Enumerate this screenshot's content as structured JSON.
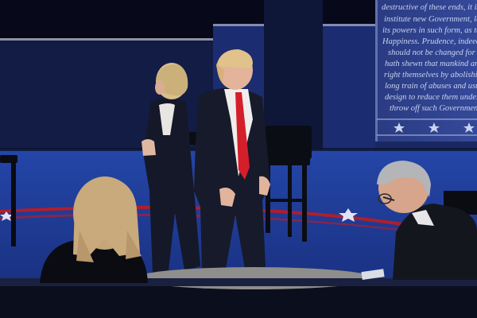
{
  "scene": {
    "banner_lines": [
      "destructive of these ends, it is the",
      "institute new Government, laying",
      "its powers in such form, as to the",
      "Happiness. Prudence, indeed",
      "should not be changed for light",
      "hath shewn that mankind are more",
      "right themselves by abolishing the",
      "long train of abuses and usurpations",
      "design to reduce them under absolute",
      "throw off such Government, and"
    ],
    "colors": {
      "stage_floor": "#1f3f9a",
      "back_wall": "#101a3d",
      "banner": "#2b3f86",
      "red_stripe": "#b01e2c",
      "suit_dark": "#151826",
      "tie_red": "#d41f2b"
    }
  }
}
